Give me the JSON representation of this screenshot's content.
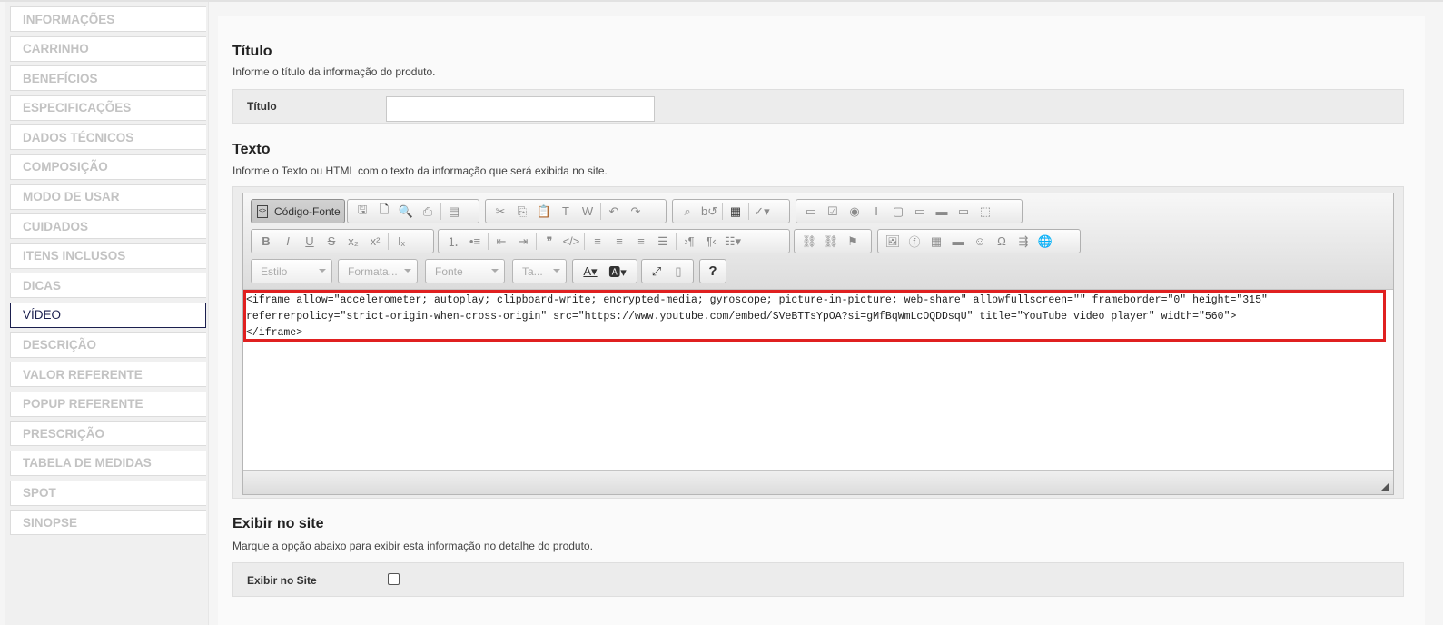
{
  "sidebar": {
    "items": [
      {
        "label": "INFORMAÇÕES"
      },
      {
        "label": "CARRINHO"
      },
      {
        "label": "BENEFÍCIOS"
      },
      {
        "label": "ESPECIFICAÇÕES"
      },
      {
        "label": "DADOS TÉCNICOS"
      },
      {
        "label": "COMPOSIÇÃO"
      },
      {
        "label": "MODO DE USAR"
      },
      {
        "label": "CUIDADOS"
      },
      {
        "label": "ITENS INCLUSOS"
      },
      {
        "label": "DICAS"
      },
      {
        "label": "VÍDEO"
      },
      {
        "label": "DESCRIÇÃO"
      },
      {
        "label": "VALOR REFERENTE"
      },
      {
        "label": "POPUP REFERENTE"
      },
      {
        "label": "PRESCRIÇÃO"
      },
      {
        "label": "TABELA DE MEDIDAS"
      },
      {
        "label": "SPOT"
      },
      {
        "label": "SINOPSE"
      }
    ],
    "active": "VÍDEO"
  },
  "titulo": {
    "heading": "Título",
    "description": "Informe o título da informação do produto.",
    "field_label": "Título",
    "value": ""
  },
  "texto": {
    "heading": "Texto",
    "description": "Informe o Texto ou HTML com o texto da informação que será exibida no site.",
    "source_button": "Código-Fonte",
    "combos": {
      "style": "Estilo",
      "format": "Formata...",
      "font": "Fonte",
      "size": "Ta..."
    },
    "code": "<iframe allow=\"accelerometer; autoplay; clipboard-write; encrypted-media; gyroscope; picture-in-picture; web-share\" allowfullscreen=\"\" frameborder=\"0\" height=\"315\"\nreferrerpolicy=\"strict-origin-when-cross-origin\" src=\"https://www.youtube.com/embed/SVeBTTsYpOA?si=gMfBqWmLcOQDDsqU\" title=\"YouTube video player\" width=\"560\">\n</iframe>"
  },
  "exibir": {
    "heading": "Exibir no site",
    "description": "Marque a opção abaixo para exibir esta informação no detalhe do produto.",
    "field_label": "Exibir no Site",
    "checked": false
  },
  "colors": {
    "highlight": "#e02020",
    "active_nav": "#1b1f4e"
  }
}
